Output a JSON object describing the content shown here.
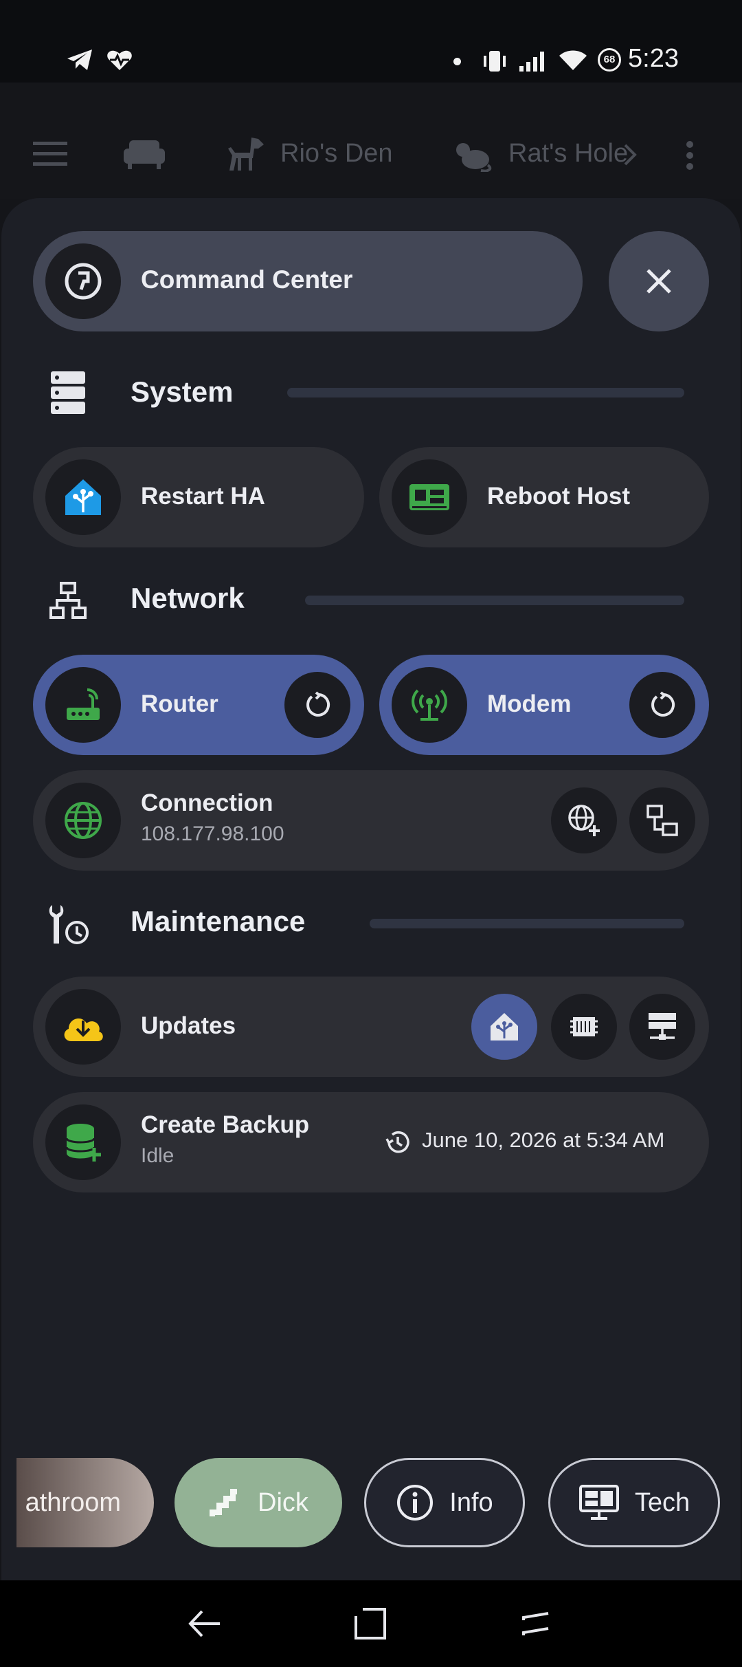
{
  "status_bar": {
    "time": "5:23",
    "battery": "68"
  },
  "top_nav": {
    "tabs": [
      "Rio's Den",
      "Rat's Hole"
    ]
  },
  "sheet": {
    "title": "Command Center",
    "sections": {
      "system": {
        "title": "System"
      },
      "network": {
        "title": "Network"
      },
      "maintenance": {
        "title": "Maintenance"
      }
    },
    "system_buttons": {
      "restart": "Restart HA",
      "reboot": "Reboot Host"
    },
    "network_buttons": {
      "router": "Router",
      "modem": "Modem"
    },
    "connection": {
      "label": "Connection",
      "ip": "108.177.98.100"
    },
    "updates": {
      "label": "Updates"
    },
    "backup": {
      "label": "Create Backup",
      "state": "Idle",
      "last": "June 10, 2026 at 5:34 AM"
    }
  },
  "bottom_chips": {
    "bathroom": "athroom",
    "dick": "Dick",
    "info": "Info",
    "tech": "Tech"
  },
  "colors": {
    "accent_blue": "#4b5d9e",
    "ha_blue": "#1e9ae6",
    "green": "#3fa84a",
    "update_yellow": "#f5c518"
  }
}
